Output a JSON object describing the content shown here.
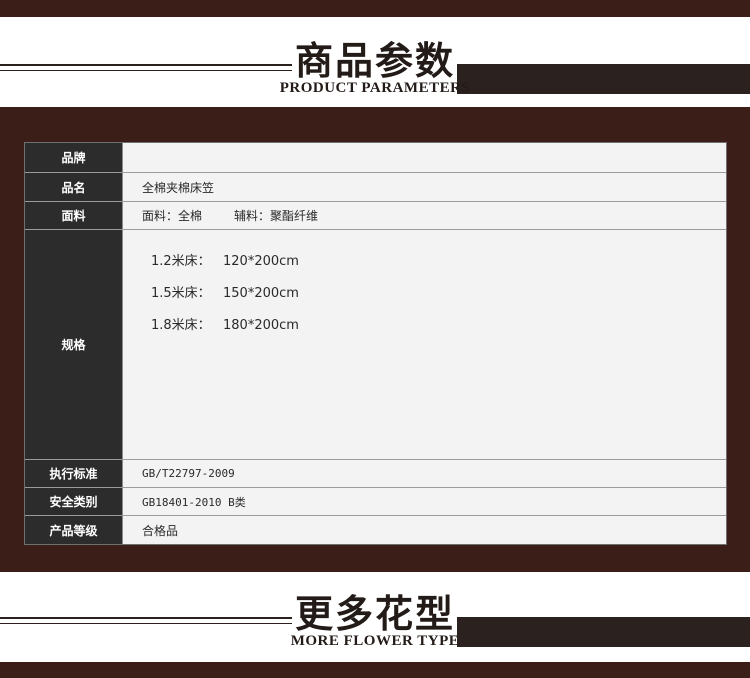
{
  "header_top": {
    "title_cn": "商品参数",
    "title_en": "PRODUCT PARAMETERS"
  },
  "table": {
    "brand_label": "品牌",
    "brand_value": "",
    "name_label": "品名",
    "name_value": "全棉夹棉床笠",
    "fabric_label": "面料",
    "fabric_main": "面料：全棉",
    "fabric_aux": "辅料：聚酯纤维",
    "spec_label": "规格",
    "specs": [
      {
        "size": "1.2米床：",
        "dim": "120*200cm"
      },
      {
        "size": "1.5米床：",
        "dim": "150*200cm"
      },
      {
        "size": "1.8米床：",
        "dim": "180*200cm"
      }
    ],
    "standard_label": "执行标准",
    "standard_value": "GB/T22797-2009",
    "safety_label": "安全类别",
    "safety_value": "GB18401-2010 B类",
    "grade_label": "产品等级",
    "grade_value": "合格品"
  },
  "header_bottom": {
    "title_cn": "更多花型",
    "title_en": "MORE FLOWER TYPE"
  },
  "colors": {
    "band": "#3a1e17",
    "label_bg": "#2c2c2c",
    "table_bg": "#f3f3f3"
  }
}
